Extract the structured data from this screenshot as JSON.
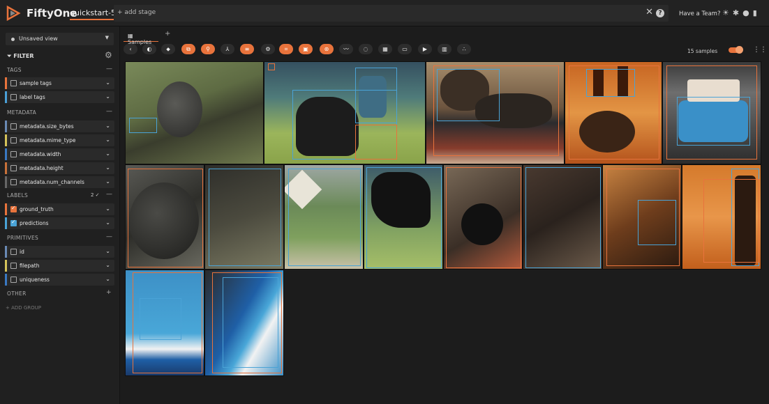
{
  "topbar": {
    "brand": "FiftyOne",
    "dataset": "quickstart-5",
    "add_stage": "+ add stage",
    "clear_symbol": "✕",
    "help_symbol": "?",
    "team_label": "Have a Team?",
    "icons": [
      "sun-icon",
      "slack-icon",
      "github-icon",
      "docs-icon"
    ]
  },
  "sidebar": {
    "view_label": "Unsaved view",
    "filter_label": "FILTER",
    "sections": {
      "tags": "TAGS",
      "metadata": "METADATA",
      "labels": "LABELS",
      "labels_count": "2 ✓",
      "primitives": "PRIMITIVES",
      "other": "OTHER"
    },
    "tag_rows": [
      {
        "label": "sample tags",
        "color": "#e8733c",
        "checked": false
      },
      {
        "label": "label tags",
        "color": "#4a9fd6",
        "checked": false
      }
    ],
    "metadata_rows": [
      {
        "label": "metadata.size_bytes",
        "color": "#6a8ab5"
      },
      {
        "label": "metadata.mime_type",
        "color": "#d4c35a"
      },
      {
        "label": "metadata.width",
        "color": "#3a78c2"
      },
      {
        "label": "metadata.height",
        "color": "#c9713a"
      },
      {
        "label": "metadata.num_channels",
        "color": "#666666"
      }
    ],
    "label_rows": [
      {
        "label": "ground_truth",
        "color": "#e8733c",
        "checked": true
      },
      {
        "label": "predictions",
        "color": "#4aa3d6",
        "checked": true
      }
    ],
    "primitive_rows": [
      {
        "label": "id",
        "color": "#6a8ab5"
      },
      {
        "label": "filepath",
        "color": "#d4c35a"
      },
      {
        "label": "uniqueness",
        "color": "#3a78c2"
      }
    ],
    "add_group": "+ ADD GROUP"
  },
  "main": {
    "tab_label": "Samples",
    "tab_add": "+",
    "samples_count": "15 samples",
    "accent_color": "#e8733c"
  }
}
